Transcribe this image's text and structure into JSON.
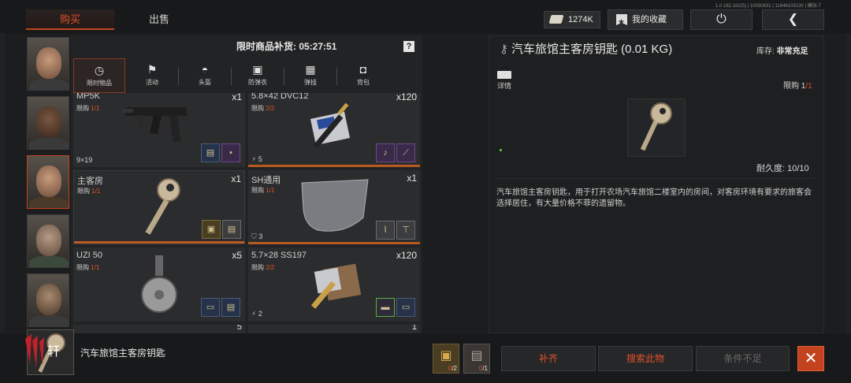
{
  "header": {
    "tabs": [
      {
        "label": "购买",
        "active": true
      },
      {
        "label": "出售",
        "active": false
      }
    ],
    "version": "1.0.162.162(5) | 10030631 | 11646103130 | 模拟-7",
    "currency": "1274K",
    "favorites_label": "我的收藏",
    "power_icon": "power-icon",
    "back_icon": "back-arrow-icon"
  },
  "traders": [
    {
      "name": "trader-1"
    },
    {
      "name": "trader-2"
    },
    {
      "name": "trader-3",
      "selected": true
    },
    {
      "name": "trader-4"
    },
    {
      "name": "trader-5"
    }
  ],
  "shop": {
    "restock_label": "限时商品补货: 05:27:51",
    "help": "?",
    "categories": [
      {
        "label": "限时物品",
        "icon": "clock-icon",
        "active": true
      },
      {
        "label": "活动",
        "icon": "event-icon"
      },
      {
        "label": "头盔",
        "icon": "helmet-icon"
      },
      {
        "label": "防弹衣",
        "icon": "vest-icon"
      },
      {
        "label": "弹挂",
        "icon": "rig-icon"
      },
      {
        "label": "背包",
        "icon": "backpack-icon"
      }
    ],
    "items": [
      {
        "name": "MP5K",
        "limit_prefix": "限购 ",
        "limit": "1/1",
        "qty": "x1",
        "sub": "9×19"
      },
      {
        "name": "5.8×42 DVC12",
        "limit_prefix": "限购 ",
        "limit": "2/2",
        "qty": "x120",
        "sub": "5"
      },
      {
        "name": "主客房",
        "limit_prefix": "限购 ",
        "limit": "1/1",
        "qty": "x1",
        "sub": ""
      },
      {
        "name": "SH通用",
        "limit_prefix": "限购 ",
        "limit": "1/1",
        "qty": "x1",
        "sub": "3"
      },
      {
        "name": "UZI 50",
        "limit_prefix": "限购 ",
        "limit": "1/1",
        "qty": "x5",
        "sub": ""
      },
      {
        "name": "5.7×28 SS197",
        "limit_prefix": "限购 ",
        "limit": "2/2",
        "qty": "x120",
        "sub": "2"
      }
    ],
    "partial_row": [
      {
        "name": "...",
        "qty": "5"
      },
      {
        "name": "...",
        "qty": "1"
      }
    ]
  },
  "detail": {
    "title": "汽车旅馆主客房钥匙 (0.01 KG)",
    "stock_label": "库存:",
    "stock_value": "非常充足",
    "detail_label": "详情",
    "limit_prefix": "限购 ",
    "limit_used": "1",
    "limit_total": "/1",
    "durability": "耐久度: 10/10",
    "description": "汽车旅馆主客房钥匙，用于打开农场汽车旅馆二楼室内的房间，对客房环境有要求的旅客会选择居住，有大量价格不菲的遗留物。"
  },
  "bottom": {
    "logo_text": "轩",
    "selected_name": "汽车旅馆主客房钥匙",
    "requirements": [
      {
        "icon": "gold-box-icon",
        "have": "0",
        "need": "/2"
      },
      {
        "icon": "book-icon",
        "have": "0",
        "need": "/1"
      }
    ],
    "fill_label": "补齐",
    "search_label": "搜索此物",
    "condition_label": "条件不足",
    "close_icon": "close-icon"
  }
}
